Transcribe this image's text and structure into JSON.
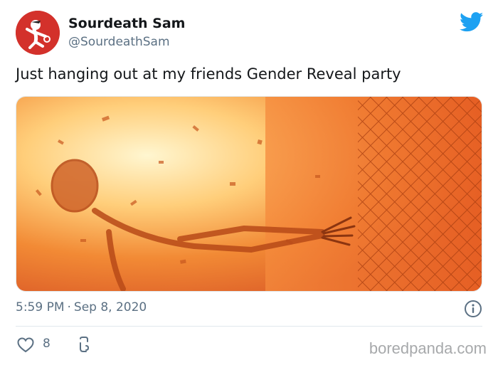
{
  "tweet": {
    "display_name": "Sourdeath Sam",
    "handle": "@SourdeathSam",
    "text": "Just hanging out at my friends Gender Reveal party",
    "time": "5:59 PM",
    "separator": "·",
    "date": "Sep 8, 2020",
    "likes": "8",
    "media": "skeleton-explosion-image"
  },
  "icons": {
    "brand": "twitter-bird-icon",
    "info": "info-icon",
    "like": "heart-icon",
    "reply": "comment-icon"
  },
  "colors": {
    "twitter_blue": "#1da1f2",
    "avatar_red": "#d3312b",
    "muted_text": "#5b7083",
    "explosion_orange": "#f07a2a"
  },
  "watermark": "boredpanda.com"
}
